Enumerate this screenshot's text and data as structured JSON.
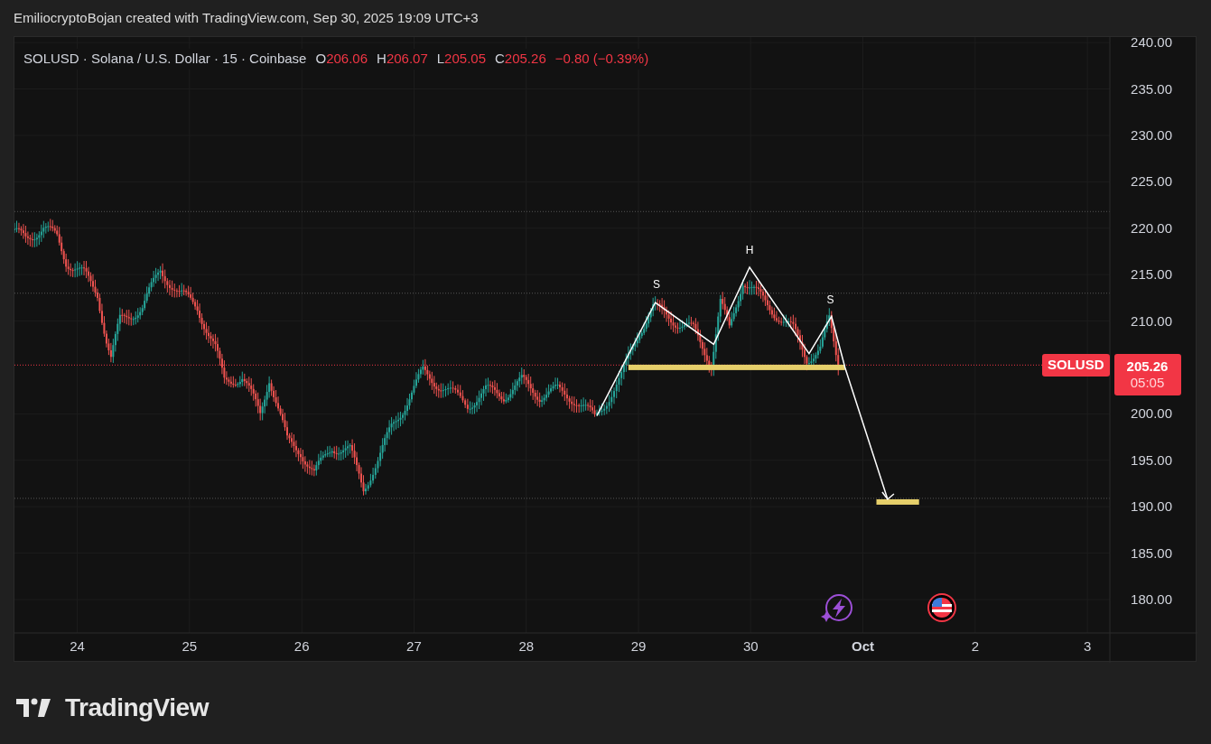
{
  "header": {
    "caption": "EmiliocryptoBojan created with TradingView.com, Sep 30, 2025 19:09 UTC+3"
  },
  "legend": {
    "symbol_text": "SOLUSD · Solana / U.S. Dollar · 15 · Coinbase",
    "ohlc": [
      {
        "label": "O",
        "value": "206.06"
      },
      {
        "label": "H",
        "value": "206.07"
      },
      {
        "label": "L",
        "value": "205.05"
      },
      {
        "label": "C",
        "value": "205.26"
      }
    ],
    "change": "−0.80 (−0.39%)"
  },
  "price_tag": {
    "symbol": "SOLUSD",
    "price": "205.26",
    "countdown": "05:05"
  },
  "chart": {
    "price_axis": [
      "240.00",
      "235.00",
      "230.00",
      "225.00",
      "220.00",
      "215.00",
      "210.00",
      "200.00",
      "195.00",
      "190.00",
      "185.00",
      "180.00"
    ],
    "time_axis": [
      "24",
      "25",
      "26",
      "27",
      "28",
      "29",
      "30",
      "Oct",
      "2",
      "3"
    ],
    "pattern_labels": [
      "S",
      "H",
      "S"
    ]
  },
  "footer": {
    "brand": "TradingView"
  }
}
